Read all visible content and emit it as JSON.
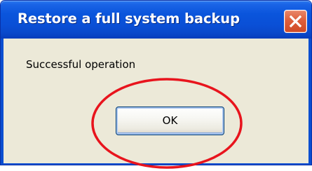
{
  "dialog": {
    "title": "Restore a full system backup",
    "message": "Successful operation",
    "ok_label": "OK",
    "close_icon": "close-icon"
  },
  "colors": {
    "titlebar": "#0a4fd6",
    "client_background": "#ece9d8",
    "close_button": "#de5f3c",
    "annotation": "#e8141d"
  }
}
